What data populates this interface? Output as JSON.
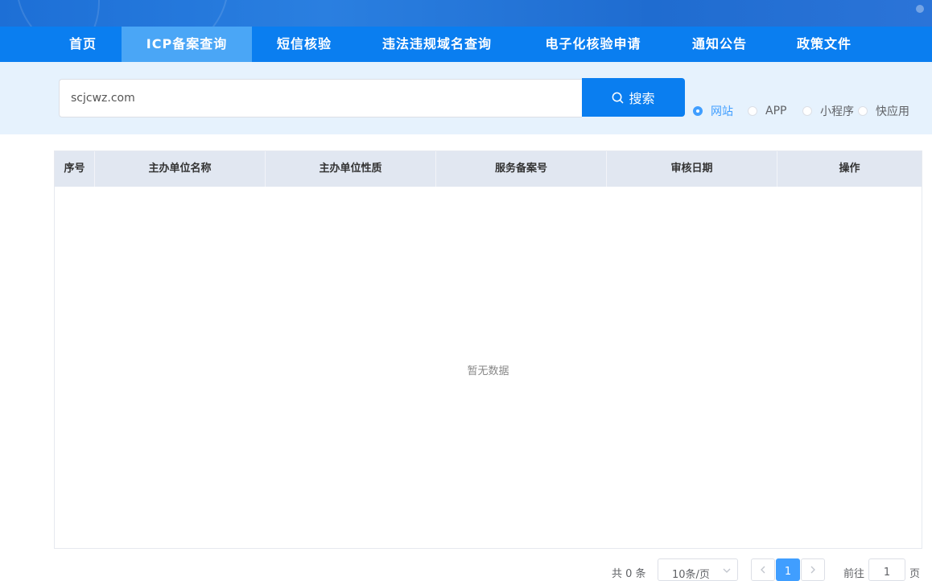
{
  "nav": {
    "items": [
      {
        "label": "首页"
      },
      {
        "label": "ICP备案查询"
      },
      {
        "label": "短信核验"
      },
      {
        "label": "违法违规域名查询"
      },
      {
        "label": "电子化核验申请"
      },
      {
        "label": "通知公告"
      },
      {
        "label": "政策文件"
      }
    ],
    "active_index": 1
  },
  "search": {
    "value": "scjcwz.com",
    "button_label": "搜索",
    "button_icon": "search-icon",
    "types": [
      {
        "label": "网站",
        "checked": true
      },
      {
        "label": "APP",
        "checked": false
      },
      {
        "label": "小程序",
        "checked": false
      },
      {
        "label": "快应用",
        "checked": false
      }
    ]
  },
  "table": {
    "columns": [
      "序号",
      "主办单位名称",
      "主办单位性质",
      "服务备案号",
      "审核日期",
      "操作"
    ],
    "rows": [],
    "empty_text": "暂无数据"
  },
  "pagination": {
    "total": "共 0 条",
    "page_size": "10条/页",
    "current_page": "1",
    "goto_label": "前往",
    "goto_value": "1",
    "page_suffix": "页"
  },
  "colors": {
    "nav_bg": "#0a7ef0",
    "nav_active": "#4aa6f6",
    "search_band": "#e6f2fd",
    "accent": "#409eff",
    "table_header": "#e1e7f1"
  }
}
